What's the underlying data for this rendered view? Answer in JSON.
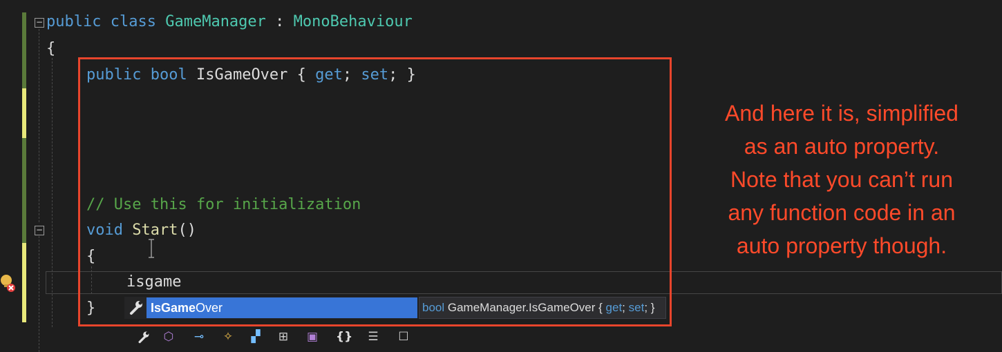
{
  "code": {
    "line1": {
      "kw": "public",
      "kw2": "class",
      "name": "GameManager",
      "sep": " : ",
      "base": "MonoBehaviour"
    },
    "line2": "{",
    "line3": {
      "kw": "public",
      "kw2": "bool",
      "name": "IsGameOver",
      "open": " { ",
      "get": "get",
      "semi1": "; ",
      "set": "set",
      "close": "; }"
    },
    "comment": "// Use this for initialization",
    "start_line": {
      "kw": "void",
      "name": "Start",
      "parens": "()"
    },
    "open_brace": "{",
    "typed_text": "isgame",
    "close_brace": "}"
  },
  "autocomplete": {
    "selected_match": "IsGame",
    "selected_rest": "Over",
    "tooltip": {
      "type": "bool",
      "member": "GameManager.IsGameOver",
      "open": " { ",
      "get": "get",
      "semi1": "; ",
      "set": "set",
      "close": "; }"
    },
    "filter_icons": [
      "wrench-icon",
      "cube-icon",
      "key-link-icon",
      "class-icon",
      "structure-icon",
      "namespace-icon",
      "briefcase-icon",
      "braces-icon",
      "snippet-icon",
      "blank-box-icon"
    ]
  },
  "caption": {
    "lines": [
      "And here it is, simplified",
      "as an auto property.",
      "Note that you can’t run",
      "any function code in an",
      "auto property though."
    ]
  },
  "colors": {
    "highlight_box": "#e8452c",
    "caption": "#ff4a2a",
    "selection": "#3875d7"
  }
}
